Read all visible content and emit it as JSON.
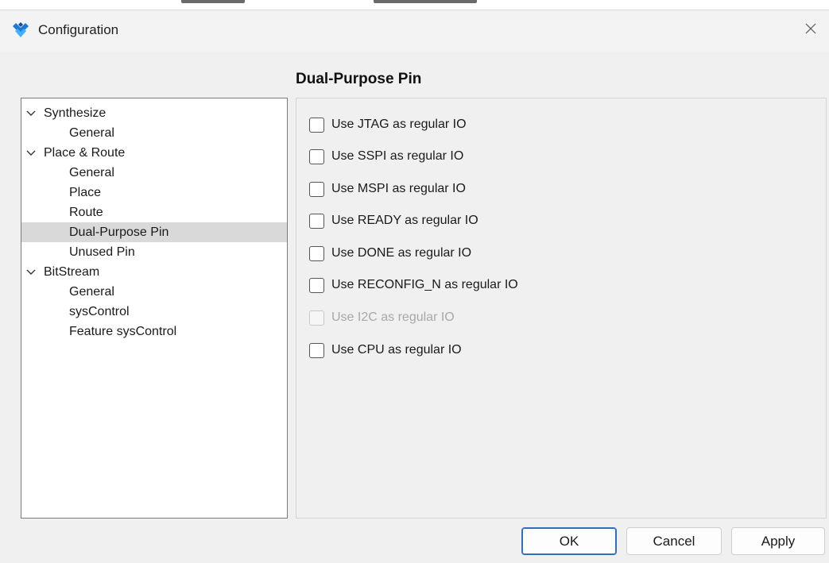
{
  "window": {
    "title": "Configuration",
    "icon": "gowin-logo-icon",
    "close_icon": "close-icon"
  },
  "page": {
    "heading": "Dual-Purpose Pin"
  },
  "tree": {
    "groups": [
      {
        "label": "Synthesize",
        "children": [
          "General"
        ]
      },
      {
        "label": "Place & Route",
        "children": [
          "General",
          "Place",
          "Route",
          "Dual-Purpose Pin",
          "Unused Pin"
        ]
      },
      {
        "label": "BitStream",
        "children": [
          "General",
          "sysControl",
          "Feature sysControl"
        ]
      }
    ],
    "selected": "Dual-Purpose Pin"
  },
  "options": [
    {
      "label": "Use JTAG as regular IO",
      "checked": false,
      "enabled": true
    },
    {
      "label": "Use SSPI as regular IO",
      "checked": false,
      "enabled": true
    },
    {
      "label": "Use MSPI as regular IO",
      "checked": false,
      "enabled": true
    },
    {
      "label": "Use READY as regular IO",
      "checked": false,
      "enabled": true
    },
    {
      "label": "Use DONE as regular IO",
      "checked": false,
      "enabled": true
    },
    {
      "label": "Use RECONFIG_N as regular IO",
      "checked": false,
      "enabled": true
    },
    {
      "label": "Use I2C as regular IO",
      "checked": false,
      "enabled": false
    },
    {
      "label": "Use CPU  as regular IO",
      "checked": false,
      "enabled": true
    }
  ],
  "buttons": {
    "ok": "OK",
    "cancel": "Cancel",
    "apply": "Apply"
  },
  "colors": {
    "accent": "#2f6fbf",
    "selection": "#d9d9d9",
    "logo_blue": "#1e78d6"
  }
}
